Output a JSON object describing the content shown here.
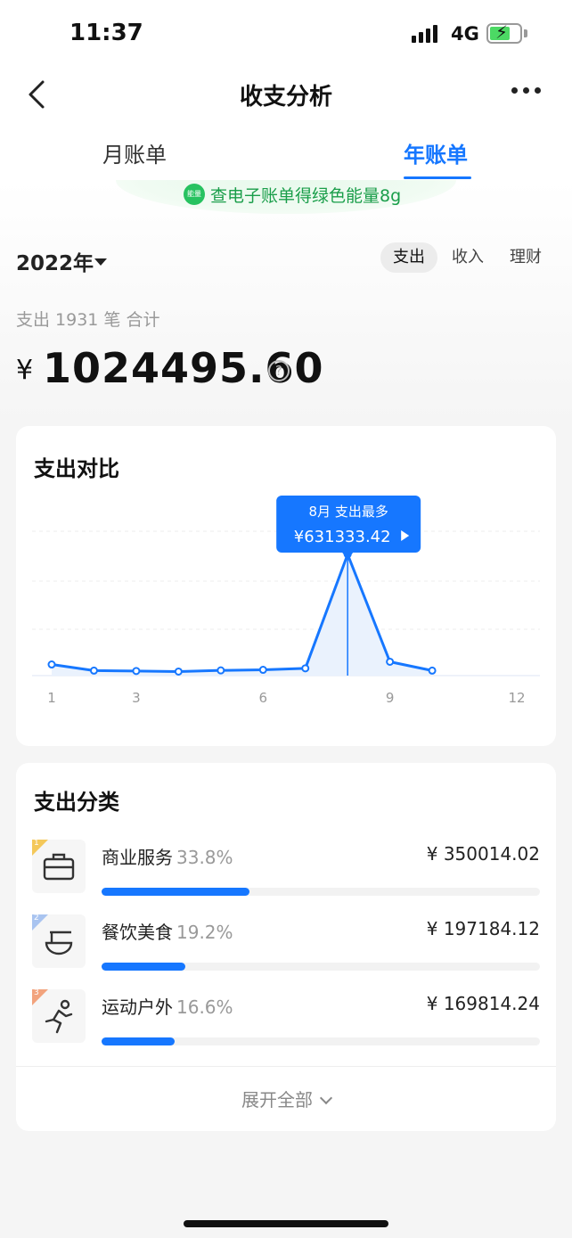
{
  "status": {
    "time": "11:37",
    "network": "4G"
  },
  "nav": {
    "title": "收支分析"
  },
  "tabs": [
    {
      "label": "月账单",
      "active": false
    },
    {
      "label": "年账单",
      "active": true
    }
  ],
  "energy": {
    "icon_text": "能量",
    "text": "查电子账单得绿色能量8g"
  },
  "filter": {
    "year": "2022年",
    "segments": [
      {
        "label": "支出",
        "active": true
      },
      {
        "label": "收入",
        "active": false
      },
      {
        "label": "理财",
        "active": false
      }
    ]
  },
  "summary": {
    "label": "支出 1931 笔 合计",
    "currency": "¥",
    "amount": "1024495.60"
  },
  "compare": {
    "title": "支出对比",
    "tooltip": {
      "title": "8月 支出最多",
      "value": "¥631333.42"
    },
    "chart_data": {
      "type": "line",
      "x": [
        1,
        2,
        3,
        4,
        5,
        6,
        7,
        8,
        9,
        10
      ],
      "values": [
        58000,
        26000,
        24000,
        21000,
        27000,
        30000,
        38000,
        631333.42,
        72000,
        26000
      ],
      "x_ticks": [
        "1",
        "3",
        "6",
        "9",
        "12"
      ],
      "x_tick_positions": [
        1,
        3,
        6,
        9,
        12
      ],
      "xlim": [
        1,
        12
      ],
      "highlight_month": 8,
      "grid": true,
      "accent_color": "#1677ff"
    }
  },
  "categories": {
    "title": "支出分类",
    "items": [
      {
        "rank": "1",
        "name": "商业服务",
        "pct": "33.8%",
        "amount": "¥ 350014.02",
        "share": 0.338,
        "icon": "briefcase-icon"
      },
      {
        "rank": "2",
        "name": "餐饮美食",
        "pct": "19.2%",
        "amount": "¥ 197184.12",
        "share": 0.192,
        "icon": "bowl-icon"
      },
      {
        "rank": "3",
        "name": "运动户外",
        "pct": "16.6%",
        "amount": "¥ 169814.24",
        "share": 0.166,
        "icon": "runner-icon"
      }
    ],
    "expand_label": "展开全部"
  }
}
